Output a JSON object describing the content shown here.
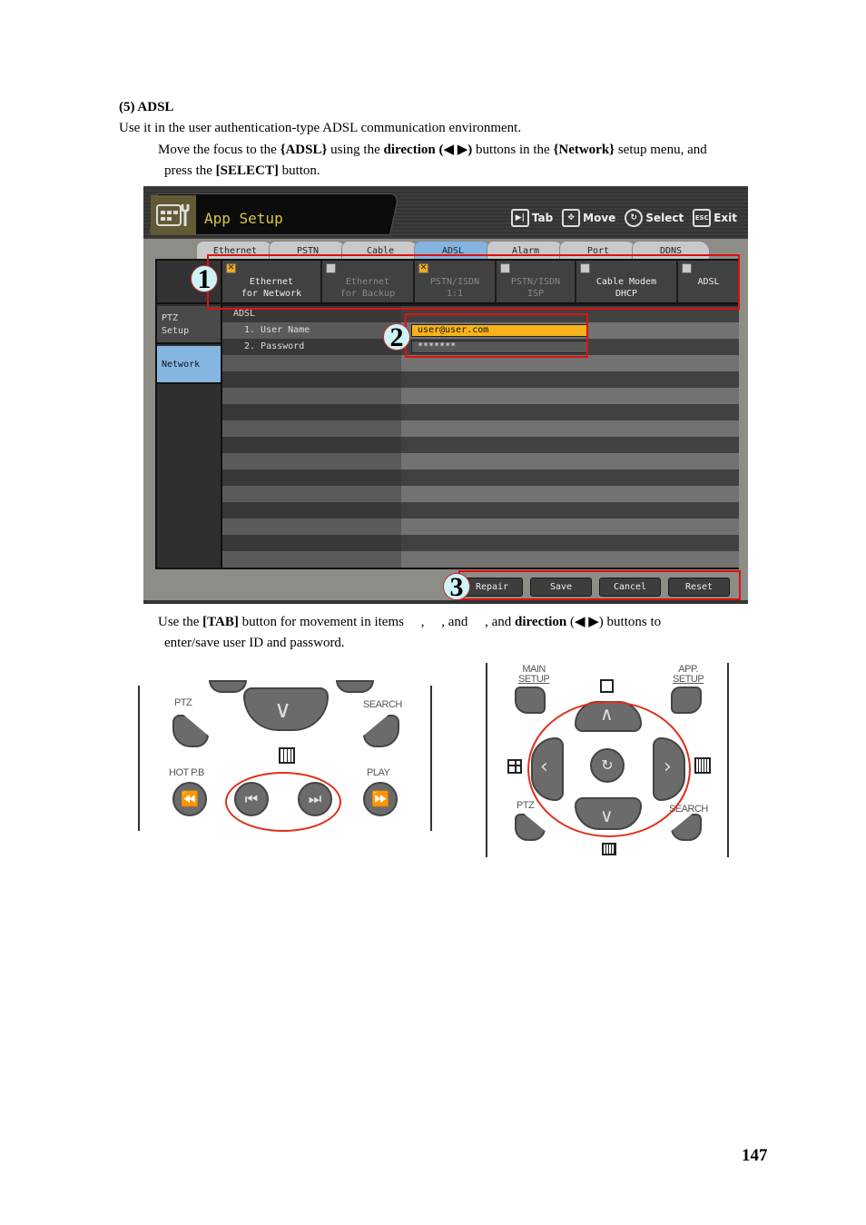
{
  "document": {
    "section_heading": "(5)  ADSL",
    "intro": "Use it in the user authentication-type ADSL communication environment.",
    "step1": {
      "p1": "Move the focus to the ",
      "b1": "{ADSL}",
      "p2": " using the ",
      "b2": "direction (◀ ▶)",
      "p3": " buttons in the ",
      "b3": "{Network}",
      "p4": " setup menu, and",
      "line2_p1": "press the ",
      "line2_b1": "[SELECT]",
      "line2_p2": " button."
    },
    "step2": {
      "p1": "Use the ",
      "b1": "[TAB]",
      "p2": " button for movement in items     ,     , and     , and ",
      "b2": "direction",
      "p3": " (◀ ▶) buttons to",
      "line2": "enter/save user ID and password."
    },
    "page_number": "147"
  },
  "dvr_ui": {
    "title": "App Setup",
    "title_icon": "app-setup-icon",
    "hints": [
      {
        "icon": "tab-icon",
        "glyph": "▶|",
        "label": "Tab"
      },
      {
        "icon": "move-icon",
        "glyph": "✥",
        "label": "Move"
      },
      {
        "icon": "select-icon",
        "glyph": "↻",
        "label": "Select"
      },
      {
        "icon": "esc-icon",
        "glyph": "ESC",
        "label": "Exit"
      }
    ],
    "tabs": [
      {
        "label": "Ethernet",
        "active": false
      },
      {
        "label": "PSTN",
        "active": false
      },
      {
        "label": "Cable",
        "active": false
      },
      {
        "label": "ADSL",
        "active": true
      },
      {
        "label": "Alarm",
        "active": false
      },
      {
        "label": "Port",
        "active": false
      },
      {
        "label": "DDNS",
        "active": false
      }
    ],
    "left_menu": [
      {
        "label": "PTZ Setup",
        "line1": "PTZ",
        "line2": "Setup",
        "active": false
      },
      {
        "label": "Network",
        "active": true
      }
    ],
    "subtabs": [
      {
        "line1": "Ethernet",
        "line2": "for Network",
        "checked": true,
        "enabled": true
      },
      {
        "line1": "Ethernet",
        "line2": "for Backup",
        "checked": false,
        "enabled": false
      },
      {
        "line1": "PSTN/ISDN",
        "line2": "1:1",
        "checked": true,
        "enabled": false
      },
      {
        "line1": "PSTN/ISDN",
        "line2": "ISP",
        "checked": false,
        "enabled": false
      },
      {
        "line1": "Cable Modem",
        "line2": "DHCP",
        "checked": false,
        "enabled": true
      },
      {
        "line1": "ADSL",
        "line2": "",
        "checked": false,
        "enabled": true
      }
    ],
    "section_label": "ADSL",
    "fields": [
      {
        "label": "1. User Name",
        "value": "user@user.com"
      },
      {
        "label": "2. Password",
        "value": "*******"
      }
    ],
    "buttons": [
      "Repair",
      "Save",
      "Cancel",
      "Reset"
    ],
    "callouts": [
      "1",
      "2",
      "3"
    ]
  },
  "remote_left": {
    "labels": {
      "ptz": "PTZ",
      "search": "SEARCH",
      "hot_pb": "HOT P.B",
      "play": "PLAY"
    },
    "buttons": [
      "down-arrow",
      "grid-16",
      "rewind",
      "prev-track",
      "next-track",
      "fast-forward"
    ]
  },
  "remote_right": {
    "labels": {
      "main_setup_1": "MAIN",
      "main_setup_2": "SETUP",
      "app_setup_1": "APP.",
      "app_setup_2": "SETUP",
      "ptz": "PTZ",
      "search": "SEARCH"
    },
    "buttons": [
      "up",
      "left",
      "select",
      "right",
      "down"
    ]
  }
}
